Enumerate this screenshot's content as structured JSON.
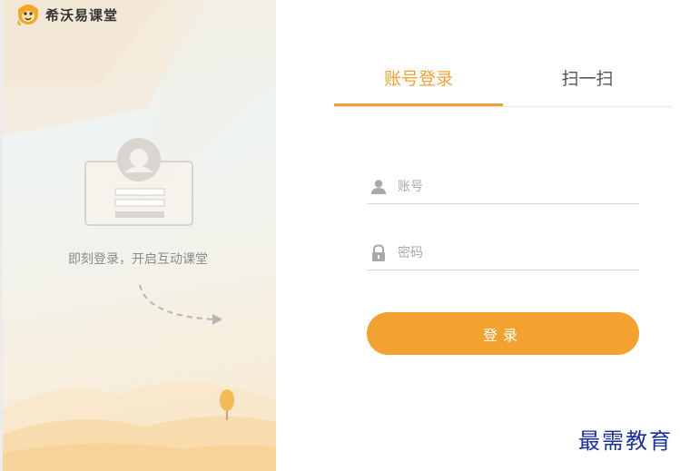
{
  "brand": {
    "name": "希沃易课堂",
    "logo_icon": "monkey-face-logo"
  },
  "left_panel": {
    "caption": "即刻登录，开启互动课堂",
    "illustration": "user-card-icon",
    "accent_colors": [
      "#f6efe0",
      "#fbe9cf",
      "#f5d9a8"
    ]
  },
  "tabs": [
    {
      "label": "账号登录",
      "active": true
    },
    {
      "label": "扫一扫",
      "active": false
    }
  ],
  "form": {
    "account": {
      "placeholder": "账号",
      "value": "",
      "icon": "user-icon"
    },
    "password": {
      "placeholder": "密码",
      "value": "",
      "icon": "lock-icon"
    },
    "submit_label": "登录"
  },
  "watermark": "最需教育",
  "colors": {
    "accent": "#f4a22f",
    "text_muted": "#aaaaaa"
  }
}
